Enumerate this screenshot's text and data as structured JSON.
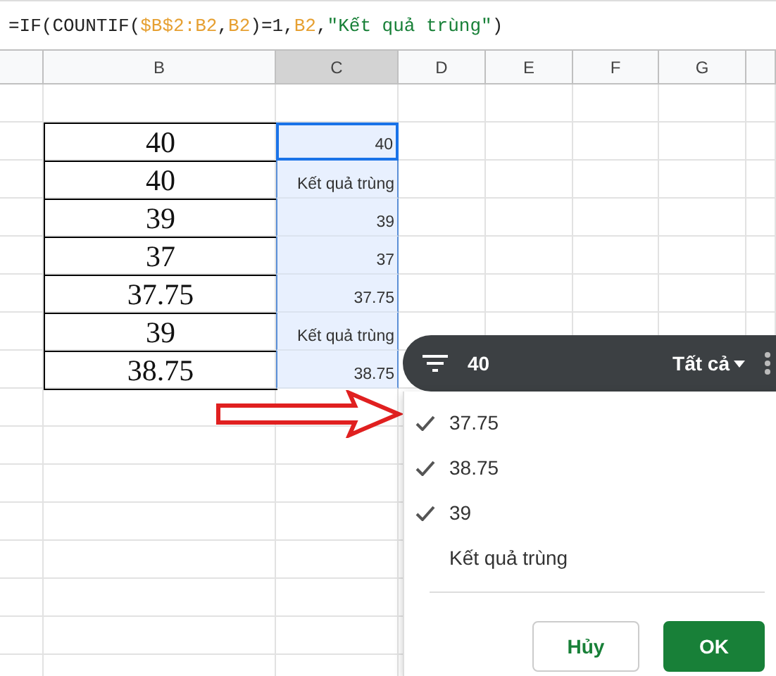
{
  "formula_bar": {
    "segments": [
      {
        "kind": "plain",
        "text": "=IF(COUNTIF("
      },
      {
        "kind": "ref",
        "text": "$B$2:B2"
      },
      {
        "kind": "plain",
        "text": ","
      },
      {
        "kind": "ref",
        "text": "B2"
      },
      {
        "kind": "plain",
        "text": ")=1,"
      },
      {
        "kind": "ref",
        "text": "B2"
      },
      {
        "kind": "plain",
        "text": ","
      },
      {
        "kind": "string",
        "text": "\"Kết quả trùng\""
      },
      {
        "kind": "plain",
        "text": ")"
      }
    ]
  },
  "columns": [
    {
      "label": "B",
      "selected": false
    },
    {
      "label": "C",
      "selected": true
    },
    {
      "label": "D",
      "selected": false
    },
    {
      "label": "E",
      "selected": false
    },
    {
      "label": "F",
      "selected": false
    },
    {
      "label": "G",
      "selected": false
    }
  ],
  "rows": [
    {
      "b": "40",
      "c": "40",
      "active": true
    },
    {
      "b": "40",
      "c": "Kết quả trùng",
      "active": false
    },
    {
      "b": "39",
      "c": "39",
      "active": false
    },
    {
      "b": "37",
      "c": "37",
      "active": false
    },
    {
      "b": "37.75",
      "c": "37.75",
      "active": false
    },
    {
      "b": "39",
      "c": "Kết quả trùng",
      "active": false
    },
    {
      "b": "38.75",
      "c": "38.75",
      "active": false
    }
  ],
  "filter_popup": {
    "value": "40",
    "condition": "Tất cả",
    "items": [
      {
        "label": "37.75",
        "checked": true
      },
      {
        "label": "38.75",
        "checked": true
      },
      {
        "label": "39",
        "checked": true
      },
      {
        "label": "Kết quả trùng",
        "checked": false
      }
    ],
    "buttons": [
      {
        "kind": "secondary",
        "label": "Hủy"
      },
      {
        "kind": "primary",
        "label": "OK"
      }
    ]
  }
}
